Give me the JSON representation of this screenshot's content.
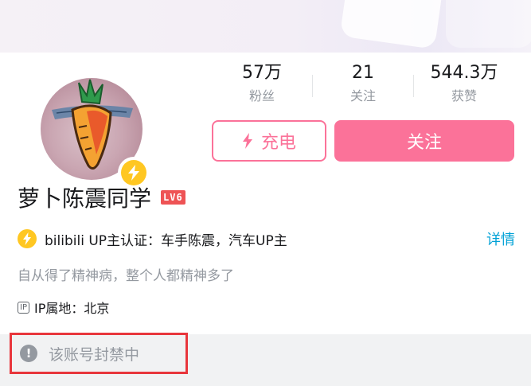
{
  "profile": {
    "name": "萝卜陈震同学",
    "level_badge": "LV6",
    "avatar_icon": "carrot-avatar",
    "charge_badge_icon": "lightning-icon"
  },
  "stats": [
    {
      "value": "57万",
      "label": "粉丝"
    },
    {
      "value": "21",
      "label": "关注"
    },
    {
      "value": "544.3万",
      "label": "获赞"
    }
  ],
  "actions": {
    "charge_label": "充电",
    "follow_label": "关注"
  },
  "certification": {
    "text": "bilibili UP主认证：车手陈震，汽车UP主",
    "detail_link": "详情"
  },
  "signature": "自从得了精神病，整个人都精神多了",
  "ip": {
    "tag": "IP",
    "text": "IP属地：北京"
  },
  "notice": {
    "icon": "!",
    "text": "该账号封禁中"
  },
  "colors": {
    "brand_pink": "#fb7299",
    "charge_yellow": "#ffc722",
    "link_blue": "#00a1d6",
    "level_red": "#ee5355",
    "highlight_red": "#e8363c"
  }
}
